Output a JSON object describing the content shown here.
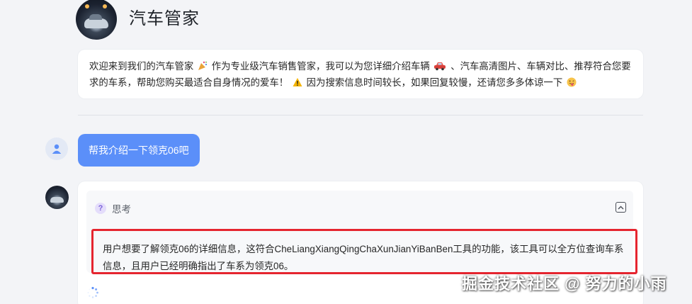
{
  "agent": {
    "title": "汽车管家"
  },
  "welcome": {
    "text_1": "欢迎来到我们的汽车管家",
    "text_2": "作为专业级汽车销售管家，我可以为您详细介绍车辆",
    "text_3": "、汽车高清图片、车辆对比、推荐符合您要求的车系，帮助您购买最适合自身情况的爱车！",
    "text_4": "因为搜索信息时间较长，如果回复较慢，还请您多多体谅一下",
    "icons": [
      "party-popper-icon",
      "car-icon",
      "warning-icon",
      "tongue-face-icon"
    ]
  },
  "conversation": {
    "user_message": "帮我介绍一下领克06吧",
    "thinking": {
      "label": "思考",
      "icon": "question-icon",
      "text": "用户想要了解领克06的详细信息，这符合CheLiangXiangQingChaXunJianYiBanBen工具的功能，该工具可以全方位查询车系信息，且用户已经明确指出了车系为领克06。"
    }
  },
  "watermark": "掘金技术社区 @ 努力的小雨",
  "colors": {
    "user_bubble": "#5b8ff9",
    "highlight_border": "#e5252f",
    "page_bg": "#f3f4f7"
  }
}
